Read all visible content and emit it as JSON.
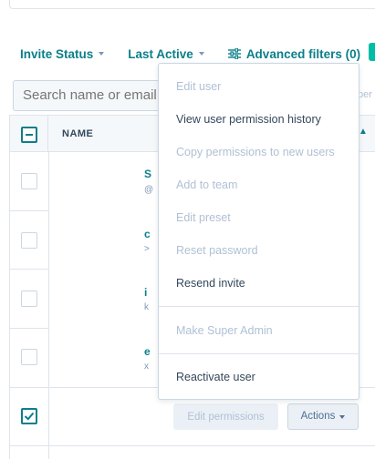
{
  "filters": {
    "invite_status": "Invite Status",
    "last_active": "Last Active",
    "advanced_filters": "Advanced filters (0)"
  },
  "search": {
    "placeholder": "Search name or email"
  },
  "right_fragment": "per",
  "table": {
    "header_name": "NAME",
    "row_fragments": [
      {
        "name": "S",
        "sub": "@"
      },
      {
        "name": "c",
        "sub": ">"
      },
      {
        "name": "i",
        "sub": "k"
      },
      {
        "name": "e",
        "sub": "x"
      }
    ]
  },
  "menu": {
    "items": [
      {
        "label": "Edit user",
        "enabled": false
      },
      {
        "label": "View user permission history",
        "enabled": true
      },
      {
        "label": "Copy permissions to new users",
        "enabled": false
      },
      {
        "label": "Add to team",
        "enabled": false
      },
      {
        "label": "Edit preset",
        "enabled": false
      },
      {
        "label": "Reset password",
        "enabled": false
      },
      {
        "label": "Resend invite",
        "enabled": true
      },
      {
        "label": "Make Super Admin",
        "enabled": false
      },
      {
        "label": "Reactivate user",
        "enabled": true
      }
    ]
  },
  "buttons": {
    "edit_permissions": "Edit permissions",
    "actions": "Actions"
  },
  "colors": {
    "accent": "#0b7f8a",
    "text": "#33475b",
    "disabled": "#b0c1d4",
    "border": "#dfe3eb",
    "chip": "#00bda5"
  }
}
